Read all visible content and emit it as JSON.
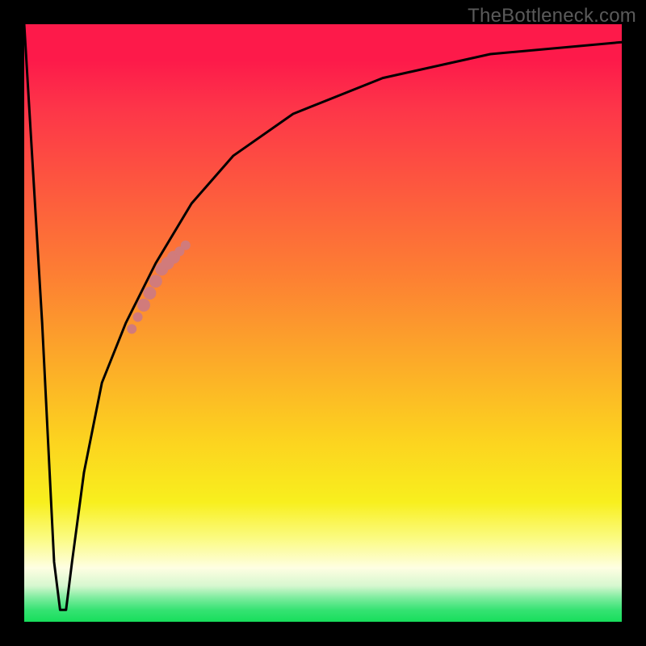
{
  "watermark": "TheBottleneck.com",
  "chart_data": {
    "type": "line",
    "title": "",
    "xlabel": "",
    "ylabel": "",
    "xlim": [
      0,
      100
    ],
    "ylim": [
      0,
      100
    ],
    "grid": false,
    "legend": false,
    "series": [
      {
        "name": "bottleneck-curve",
        "x": [
          0,
          3,
          5,
          6,
          7,
          8,
          10,
          13,
          17,
          22,
          28,
          35,
          45,
          60,
          78,
          100
        ],
        "values": [
          100,
          50,
          10,
          2,
          2,
          10,
          25,
          40,
          50,
          60,
          70,
          78,
          85,
          91,
          95,
          97
        ]
      }
    ],
    "highlighted_points": {
      "name": "highlight-region",
      "color": "#d17b7b",
      "x": [
        18,
        19,
        20,
        21,
        22,
        23,
        24,
        25,
        26,
        27
      ],
      "values": [
        49,
        51,
        53,
        55,
        57,
        59,
        60,
        61,
        62,
        63
      ]
    },
    "background_gradient": {
      "top": "#fd1a4a",
      "mid": "#fcd41f",
      "bottom": "#17de5b"
    }
  }
}
